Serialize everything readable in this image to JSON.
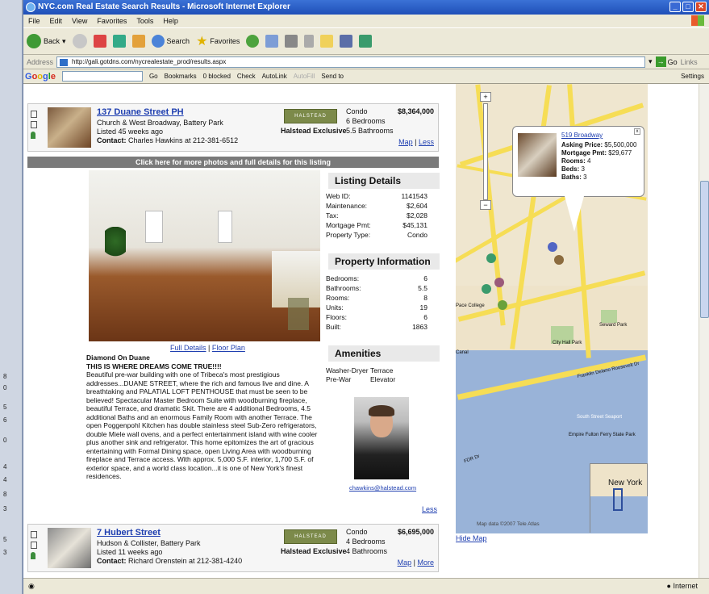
{
  "window_title": "NYC.com Real Estate Search Results - Microsoft Internet Explorer",
  "menu": [
    "File",
    "Edit",
    "View",
    "Favorites",
    "Tools",
    "Help"
  ],
  "toolbar": {
    "back": "Back",
    "search": "Search",
    "favorites": "Favorites"
  },
  "address": {
    "label": "Address",
    "url": "http://gali.gotdns.com/nycrealestate_prod/results.aspx",
    "go": "Go",
    "links": "Links"
  },
  "google": {
    "go": "Go",
    "bookmarks": "Bookmarks",
    "blocked": "0 blocked",
    "check": "Check",
    "autolink": "AutoLink",
    "autofill": "AutoFill",
    "sendto": "Send to",
    "settings": "Settings"
  },
  "left_strip": [
    "8",
    "0",
    "5",
    "6",
    "0",
    "4",
    "4",
    "8",
    "3",
    "5",
    "3"
  ],
  "listing1": {
    "address": "137 Duane Street PH",
    "cross": "Church & West Broadway, Battery Park",
    "age": "Listed 45 weeks ago",
    "contact_label": "Contact:",
    "contact": "Charles Hawkins at 212-381-6512",
    "logo": "HALSTEAD PROPERTY",
    "exclusive": "Halstead Exclusive",
    "type": "Condo",
    "beds": "6 Bedrooms",
    "baths": "5.5 Bathrooms",
    "price": "$8,364,000",
    "map": "Map",
    "less": "Less"
  },
  "photobar": "Click here for more photos and full details for this listing",
  "full_details": "Full Details",
  "floor_plan": "Floor Plan",
  "desc": {
    "title": "Diamond On Duane",
    "tagline": "THIS IS WHERE DREAMS COME TRUE!!!!",
    "body": "Beautiful pre-war building with one of Tribeca's most prestigious addresses...DUANE STREET, where the rich and famous live and dine. A breathtaking and PALATIAL LOFT PENTHOUSE that must be seen to be believed! Spectacular Master Bedroom Suite with woodburning fireplace, beautiful Terrace, and dramatic Skit. There are 4 additional Bedrooms, 4.5 additional Baths and an enormous Family Room with another Terrace. The open Poggenpohl Kitchen has double stainless steel Sub-Zero refrigerators, double Miele wall ovens, and a perfect entertainment island with wine cooler plus another sink and refrigerator. This home epitomizes the art of gracious entertaining with Formal Dining space, open Living Area with woodburning fireplace and Terrace access. With approx. 5,000 S.F. interior, 1,700 S.F. of exterior space, and a world class location...it is one of New York's finest residences."
  },
  "listing_details": {
    "heading": "Listing Details",
    "rows": [
      [
        "Web ID:",
        "1141543"
      ],
      [
        "Maintenance:",
        "$2,604"
      ],
      [
        "Tax:",
        "$2,028"
      ],
      [
        "Mortgage Pmt:",
        "$45,131"
      ],
      [
        "Property Type:",
        "Condo"
      ]
    ]
  },
  "property_info": {
    "heading": "Property Information",
    "rows": [
      [
        "Bedrooms:",
        "6"
      ],
      [
        "Bathrooms:",
        "5.5"
      ],
      [
        "Rooms:",
        "8"
      ],
      [
        "Units:",
        "19"
      ],
      [
        "Floors:",
        "6"
      ],
      [
        "Built:",
        "1863"
      ]
    ]
  },
  "amenities": {
    "heading": "Amenities",
    "items": [
      "Washer-Dryer",
      "Terrace",
      "Pre-War",
      "Elevator"
    ]
  },
  "agent_email": "chawkins@halstead.com",
  "less2": "Less",
  "listing2": {
    "address": "7 Hubert Street",
    "cross": "Hudson & Collister, Battery Park",
    "age": "Listed 11 weeks ago",
    "contact_label": "Contact:",
    "contact": "Richard Orenstein at 212-381-4240",
    "logo": "HALSTEAD PROPERTY",
    "exclusive": "Halstead Exclusive",
    "type": "Condo",
    "beds": "4 Bedrooms",
    "baths": "4 Bathrooms",
    "price": "$6,695,000",
    "map": "Map",
    "more": "More"
  },
  "popup": {
    "address": "519 Broadway",
    "asking_label": "Asking Price:",
    "asking": "$5,500,000",
    "mort_label": "Mortgage Pmt:",
    "mort": "$29,677",
    "rooms_label": "Rooms:",
    "rooms": "4",
    "beds_label": "Beds:",
    "beds": "3",
    "baths_label": "Baths:",
    "baths": "3"
  },
  "map": {
    "inset_label": "New York",
    "copyright": "Map data ©2007 Tele Atlas",
    "hide": "Hide Map",
    "labels": [
      "City Hall Park",
      "Seward Park",
      "Franklin Delano Roosevelt Dr",
      "South Street Seaport",
      "Empire Fulton Ferry State Park",
      "FDR Dr",
      "Canal",
      "Pace College"
    ]
  },
  "status": {
    "zone": "Internet"
  }
}
